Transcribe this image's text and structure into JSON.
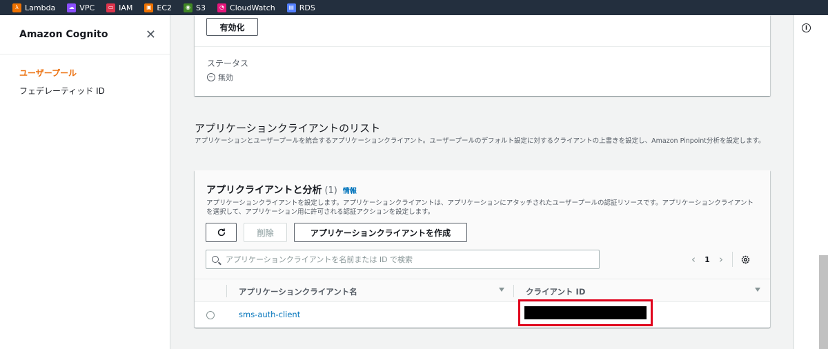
{
  "topbar": {
    "services": [
      {
        "label": "Lambda",
        "icon": "lambda-icon",
        "color": "#ed7100"
      },
      {
        "label": "VPC",
        "icon": "vpc-icon",
        "color": "#8c4fff"
      },
      {
        "label": "IAM",
        "icon": "iam-icon",
        "color": "#dd344c"
      },
      {
        "label": "EC2",
        "icon": "ec2-icon",
        "color": "#ed7100"
      },
      {
        "label": "S3",
        "icon": "s3-icon",
        "color": "#3f8624"
      },
      {
        "label": "CloudWatch",
        "icon": "cloudwatch-icon",
        "color": "#e7157b"
      },
      {
        "label": "RDS",
        "icon": "rds-icon",
        "color": "#527fff"
      }
    ]
  },
  "sidenav": {
    "title": "Amazon Cognito",
    "items": [
      {
        "label": "ユーザープール",
        "active": true
      },
      {
        "label": "フェデレーティッド ID",
        "active": false
      }
    ]
  },
  "card1": {
    "enable_button": "有効化",
    "status_label": "ステータス",
    "status_value": "無効"
  },
  "section": {
    "title": "アプリケーションクライアントのリスト",
    "description": "アプリケーションとユーザープールを統合するアプリケーションクライアント。ユーザープールのデフォルト設定に対するクライアントの上書きを設定し、Amazon Pinpoint分析を設定します。"
  },
  "clients": {
    "title": "アプリクライアントと分析",
    "count": "(1)",
    "info_link": "情報",
    "description": "アプリケーションクライアントを設定します。アプリケーションクライアントは、アプリケーションにアタッチされたユーザープールの認証リソースです。アプリケーションクライアントを選択して、アプリケーション用に許可される認証アクションを設定します。",
    "refresh_icon": "refresh-icon",
    "delete_button": "削除",
    "create_button": "アプリケーションクライアントを作成",
    "search_placeholder": "アプリケーションクライアントを名前または ID で検索",
    "page": "1",
    "columns": [
      "アプリケーションクライアント名",
      "クライアント ID"
    ],
    "rows": [
      {
        "name": "sms-auth-client",
        "client_id": ""
      }
    ],
    "colors": {
      "link": "#0073bb",
      "accent": "#ec7211",
      "highlight": "#e0001b"
    }
  }
}
